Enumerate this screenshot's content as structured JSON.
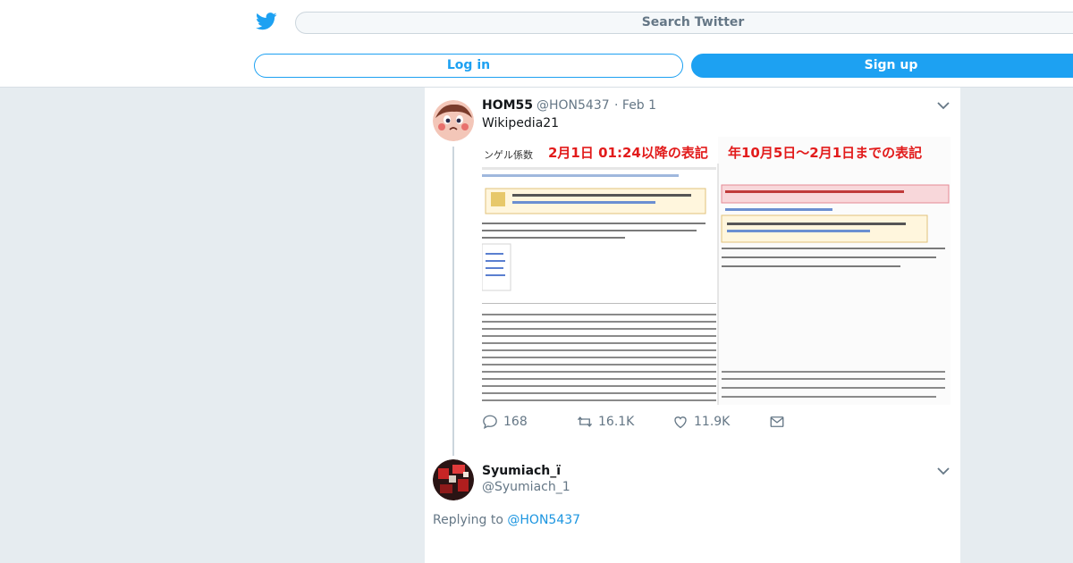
{
  "header": {
    "logo_icon": "twitter-bird-icon",
    "search_placeholder": "Search Twitter",
    "login_label": "Log in",
    "signup_label": "Sign up",
    "accent": "#1da1f2"
  },
  "tweet": {
    "name": "HOM55",
    "handle": "@HON5437",
    "date": "· Feb 1",
    "text": "Wikipedia21",
    "media": {
      "header_left": "2月1日 01:24以降の表記",
      "header_right": "年10月5日〜2月1日までの表記",
      "page_title": "ンゲル係数"
    },
    "actions": {
      "replies": "168",
      "retweets": "16.1K",
      "likes": "11.9K"
    }
  },
  "reply": {
    "name": "Syumiach_ï",
    "handle": "@Syumiach_1",
    "replying_prefix": "Replying to",
    "replying_to": "@HON5437"
  }
}
